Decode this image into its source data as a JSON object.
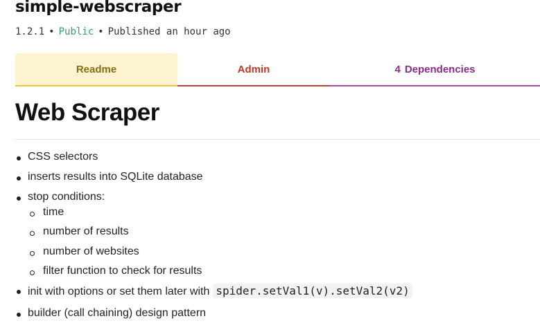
{
  "package": {
    "name": "simple-webscraper",
    "version": "1.2.1",
    "separator": "•",
    "visibility": "Public",
    "published": "Published an hour ago"
  },
  "tabs": {
    "readme": "Readme",
    "admin": "Admin",
    "dependencies_count": "4",
    "dependencies_label": "Dependencies"
  },
  "readme": {
    "heading": "Web Scraper",
    "items": [
      "CSS selectors",
      "inserts results into SQLite database",
      "stop conditions:",
      "init with options or set them later with",
      "builder (call chaining) design pattern"
    ],
    "stop_conditions": [
      "time",
      "number of results",
      "number of websites",
      "filter function to check for results"
    ],
    "code_snippet": "spider.setVal1(v).setVal2(v2)"
  },
  "colors": {
    "public": "#2f9e6f",
    "readme_tab_bg": "#fdf3d0",
    "readme_tab_text": "#8a6d12",
    "admin_tab_text": "#c0392b",
    "deps_tab_text": "#8a2a8a"
  }
}
